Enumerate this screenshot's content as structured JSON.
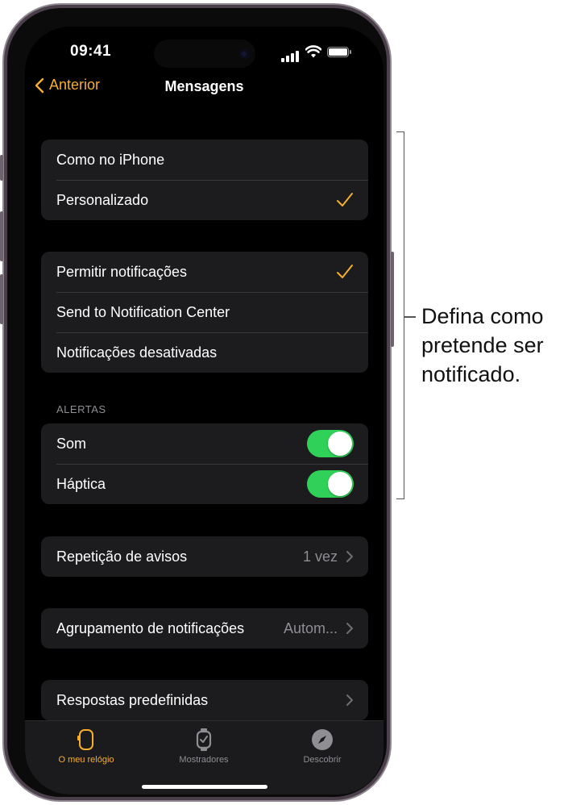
{
  "status_bar": {
    "time": "09:41"
  },
  "nav": {
    "back_label": "Anterior",
    "title": "Mensagens"
  },
  "group1": {
    "items": [
      {
        "label": "Como no iPhone",
        "checked": false
      },
      {
        "label": "Personalizado",
        "checked": true
      }
    ]
  },
  "group2": {
    "items": [
      {
        "label": "Permitir notificações",
        "checked": true
      },
      {
        "label": "Send to Notification Center",
        "checked": false
      },
      {
        "label": "Notificações desativadas",
        "checked": false
      }
    ]
  },
  "alerts": {
    "header": "ALERTAS",
    "items": [
      {
        "label": "Som",
        "on": true
      },
      {
        "label": "Háptica",
        "on": true
      }
    ]
  },
  "repeat": {
    "label": "Repetição de avisos",
    "value": "1 vez"
  },
  "grouping": {
    "label": "Agrupamento de notificações",
    "value": "Autom..."
  },
  "replies": {
    "label": "Respostas predefinidas"
  },
  "tabbar": {
    "items": [
      {
        "label": "O meu relógio",
        "icon": "watch-icon",
        "active": true
      },
      {
        "label": "Mostradores",
        "icon": "watch-face-icon",
        "active": false
      },
      {
        "label": "Descobrir",
        "icon": "compass-icon",
        "active": false
      }
    ]
  },
  "callout": {
    "lines": [
      "Defina como",
      "pretende ser",
      "notificado."
    ]
  },
  "colors": {
    "accent": "#f7ae2d",
    "toggle_on": "#30d158",
    "cell_bg": "#1c1c1e",
    "background": "#000000"
  }
}
